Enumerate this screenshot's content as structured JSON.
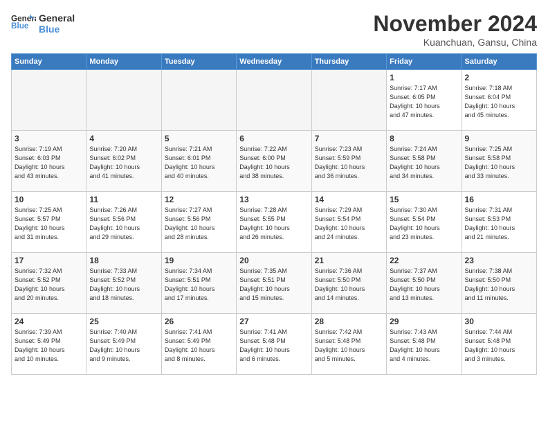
{
  "logo": {
    "name1": "General",
    "name2": "Blue"
  },
  "title": "November 2024",
  "location": "Kuanchuan, Gansu, China",
  "days_of_week": [
    "Sunday",
    "Monday",
    "Tuesday",
    "Wednesday",
    "Thursday",
    "Friday",
    "Saturday"
  ],
  "weeks": [
    [
      {
        "day": "",
        "empty": true
      },
      {
        "day": "",
        "empty": true
      },
      {
        "day": "",
        "empty": true
      },
      {
        "day": "",
        "empty": true
      },
      {
        "day": "",
        "empty": true
      },
      {
        "day": "1",
        "info": "Sunrise: 7:17 AM\nSunset: 6:05 PM\nDaylight: 10 hours\nand 47 minutes."
      },
      {
        "day": "2",
        "info": "Sunrise: 7:18 AM\nSunset: 6:04 PM\nDaylight: 10 hours\nand 45 minutes."
      }
    ],
    [
      {
        "day": "3",
        "info": "Sunrise: 7:19 AM\nSunset: 6:03 PM\nDaylight: 10 hours\nand 43 minutes."
      },
      {
        "day": "4",
        "info": "Sunrise: 7:20 AM\nSunset: 6:02 PM\nDaylight: 10 hours\nand 41 minutes."
      },
      {
        "day": "5",
        "info": "Sunrise: 7:21 AM\nSunset: 6:01 PM\nDaylight: 10 hours\nand 40 minutes."
      },
      {
        "day": "6",
        "info": "Sunrise: 7:22 AM\nSunset: 6:00 PM\nDaylight: 10 hours\nand 38 minutes."
      },
      {
        "day": "7",
        "info": "Sunrise: 7:23 AM\nSunset: 5:59 PM\nDaylight: 10 hours\nand 36 minutes."
      },
      {
        "day": "8",
        "info": "Sunrise: 7:24 AM\nSunset: 5:58 PM\nDaylight: 10 hours\nand 34 minutes."
      },
      {
        "day": "9",
        "info": "Sunrise: 7:25 AM\nSunset: 5:58 PM\nDaylight: 10 hours\nand 33 minutes."
      }
    ],
    [
      {
        "day": "10",
        "info": "Sunrise: 7:25 AM\nSunset: 5:57 PM\nDaylight: 10 hours\nand 31 minutes."
      },
      {
        "day": "11",
        "info": "Sunrise: 7:26 AM\nSunset: 5:56 PM\nDaylight: 10 hours\nand 29 minutes."
      },
      {
        "day": "12",
        "info": "Sunrise: 7:27 AM\nSunset: 5:56 PM\nDaylight: 10 hours\nand 28 minutes."
      },
      {
        "day": "13",
        "info": "Sunrise: 7:28 AM\nSunset: 5:55 PM\nDaylight: 10 hours\nand 26 minutes."
      },
      {
        "day": "14",
        "info": "Sunrise: 7:29 AM\nSunset: 5:54 PM\nDaylight: 10 hours\nand 24 minutes."
      },
      {
        "day": "15",
        "info": "Sunrise: 7:30 AM\nSunset: 5:54 PM\nDaylight: 10 hours\nand 23 minutes."
      },
      {
        "day": "16",
        "info": "Sunrise: 7:31 AM\nSunset: 5:53 PM\nDaylight: 10 hours\nand 21 minutes."
      }
    ],
    [
      {
        "day": "17",
        "info": "Sunrise: 7:32 AM\nSunset: 5:52 PM\nDaylight: 10 hours\nand 20 minutes."
      },
      {
        "day": "18",
        "info": "Sunrise: 7:33 AM\nSunset: 5:52 PM\nDaylight: 10 hours\nand 18 minutes."
      },
      {
        "day": "19",
        "info": "Sunrise: 7:34 AM\nSunset: 5:51 PM\nDaylight: 10 hours\nand 17 minutes."
      },
      {
        "day": "20",
        "info": "Sunrise: 7:35 AM\nSunset: 5:51 PM\nDaylight: 10 hours\nand 15 minutes."
      },
      {
        "day": "21",
        "info": "Sunrise: 7:36 AM\nSunset: 5:50 PM\nDaylight: 10 hours\nand 14 minutes."
      },
      {
        "day": "22",
        "info": "Sunrise: 7:37 AM\nSunset: 5:50 PM\nDaylight: 10 hours\nand 13 minutes."
      },
      {
        "day": "23",
        "info": "Sunrise: 7:38 AM\nSunset: 5:50 PM\nDaylight: 10 hours\nand 11 minutes."
      }
    ],
    [
      {
        "day": "24",
        "info": "Sunrise: 7:39 AM\nSunset: 5:49 PM\nDaylight: 10 hours\nand 10 minutes."
      },
      {
        "day": "25",
        "info": "Sunrise: 7:40 AM\nSunset: 5:49 PM\nDaylight: 10 hours\nand 9 minutes."
      },
      {
        "day": "26",
        "info": "Sunrise: 7:41 AM\nSunset: 5:49 PM\nDaylight: 10 hours\nand 8 minutes."
      },
      {
        "day": "27",
        "info": "Sunrise: 7:41 AM\nSunset: 5:48 PM\nDaylight: 10 hours\nand 6 minutes."
      },
      {
        "day": "28",
        "info": "Sunrise: 7:42 AM\nSunset: 5:48 PM\nDaylight: 10 hours\nand 5 minutes."
      },
      {
        "day": "29",
        "info": "Sunrise: 7:43 AM\nSunset: 5:48 PM\nDaylight: 10 hours\nand 4 minutes."
      },
      {
        "day": "30",
        "info": "Sunrise: 7:44 AM\nSunset: 5:48 PM\nDaylight: 10 hours\nand 3 minutes."
      }
    ]
  ]
}
